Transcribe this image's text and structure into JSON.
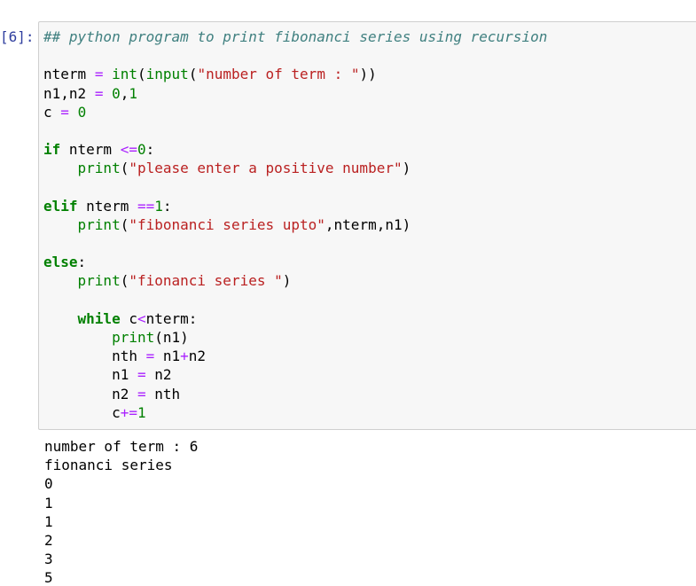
{
  "cell": {
    "prompt": "[6]:",
    "code_lines": [
      [
        {
          "t": "## python program to print fibonanci series using recursion",
          "c": "cm"
        }
      ],
      [],
      [
        {
          "t": "nterm",
          "c": "nm"
        },
        {
          "t": " ",
          "c": "nm"
        },
        {
          "t": "=",
          "c": "op"
        },
        {
          "t": " ",
          "c": "nm"
        },
        {
          "t": "int",
          "c": "bi"
        },
        {
          "t": "(",
          "c": "nm"
        },
        {
          "t": "input",
          "c": "bi"
        },
        {
          "t": "(",
          "c": "nm"
        },
        {
          "t": "\"number of term : \"",
          "c": "str"
        },
        {
          "t": "))",
          "c": "nm"
        }
      ],
      [
        {
          "t": "n1,n2",
          "c": "nm"
        },
        {
          "t": " ",
          "c": "nm"
        },
        {
          "t": "=",
          "c": "op"
        },
        {
          "t": " ",
          "c": "nm"
        },
        {
          "t": "0",
          "c": "num"
        },
        {
          "t": ",",
          "c": "nm"
        },
        {
          "t": "1",
          "c": "num"
        }
      ],
      [
        {
          "t": "c",
          "c": "nm"
        },
        {
          "t": " ",
          "c": "nm"
        },
        {
          "t": "=",
          "c": "op"
        },
        {
          "t": " ",
          "c": "nm"
        },
        {
          "t": "0",
          "c": "num"
        }
      ],
      [],
      [
        {
          "t": "if",
          "c": "kw"
        },
        {
          "t": " nterm ",
          "c": "nm"
        },
        {
          "t": "<=",
          "c": "op"
        },
        {
          "t": "0",
          "c": "num"
        },
        {
          "t": ":",
          "c": "nm"
        }
      ],
      [
        {
          "t": "    ",
          "c": "nm"
        },
        {
          "t": "print",
          "c": "bi"
        },
        {
          "t": "(",
          "c": "nm"
        },
        {
          "t": "\"please enter a positive number\"",
          "c": "str"
        },
        {
          "t": ")",
          "c": "nm"
        }
      ],
      [],
      [
        {
          "t": "elif",
          "c": "kw"
        },
        {
          "t": " nterm ",
          "c": "nm"
        },
        {
          "t": "==",
          "c": "op"
        },
        {
          "t": "1",
          "c": "num"
        },
        {
          "t": ":",
          "c": "nm"
        }
      ],
      [
        {
          "t": "    ",
          "c": "nm"
        },
        {
          "t": "print",
          "c": "bi"
        },
        {
          "t": "(",
          "c": "nm"
        },
        {
          "t": "\"fibonanci series upto\"",
          "c": "str"
        },
        {
          "t": ",nterm,n1)",
          "c": "nm"
        }
      ],
      [],
      [
        {
          "t": "else",
          "c": "kw"
        },
        {
          "t": ":",
          "c": "nm"
        }
      ],
      [
        {
          "t": "    ",
          "c": "nm"
        },
        {
          "t": "print",
          "c": "bi"
        },
        {
          "t": "(",
          "c": "nm"
        },
        {
          "t": "\"fionanci series \"",
          "c": "str"
        },
        {
          "t": ")",
          "c": "nm"
        }
      ],
      [],
      [
        {
          "t": "    ",
          "c": "nm"
        },
        {
          "t": "while",
          "c": "kw"
        },
        {
          "t": " c",
          "c": "nm"
        },
        {
          "t": "<",
          "c": "op"
        },
        {
          "t": "nterm:",
          "c": "nm"
        }
      ],
      [
        {
          "t": "        ",
          "c": "nm"
        },
        {
          "t": "print",
          "c": "bi"
        },
        {
          "t": "(n1)",
          "c": "nm"
        }
      ],
      [
        {
          "t": "        nth ",
          "c": "nm"
        },
        {
          "t": "=",
          "c": "op"
        },
        {
          "t": " n1",
          "c": "nm"
        },
        {
          "t": "+",
          "c": "op"
        },
        {
          "t": "n2",
          "c": "nm"
        }
      ],
      [
        {
          "t": "        n1 ",
          "c": "nm"
        },
        {
          "t": "=",
          "c": "op"
        },
        {
          "t": " n2",
          "c": "nm"
        }
      ],
      [
        {
          "t": "        n2 ",
          "c": "nm"
        },
        {
          "t": "=",
          "c": "op"
        },
        {
          "t": " nth",
          "c": "nm"
        }
      ],
      [
        {
          "t": "        c",
          "c": "nm"
        },
        {
          "t": "+=",
          "c": "op"
        },
        {
          "t": "1",
          "c": "num"
        }
      ]
    ],
    "output_lines": [
      "number of term : 6",
      "fionanci series",
      "0",
      "1",
      "1",
      "2",
      "3",
      "5"
    ]
  },
  "colors": {
    "prompt": "#303f9f",
    "comment": "#408080",
    "keyword": "#008000",
    "string": "#ba2121",
    "operator": "#aa22ff",
    "cell_background": "#f7f7f7",
    "cell_border": "#cfcfcf"
  }
}
